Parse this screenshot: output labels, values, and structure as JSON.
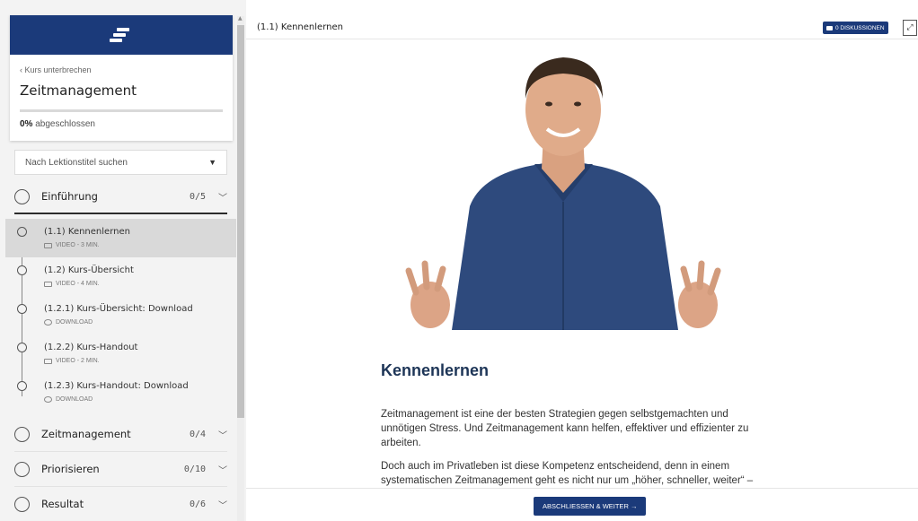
{
  "sidebar": {
    "back_link": "‹ Kurs unterbrechen",
    "course_title": "Zeitmanagement",
    "progress_value": 0,
    "progress_percent": "0%",
    "progress_suffix": "abgeschlossen",
    "search_placeholder": "Nach Lektionstitel suchen",
    "chapters": [
      {
        "title": "Einführung",
        "count": "0/5",
        "expanded": true
      },
      {
        "title": "Zeitmanagement",
        "count": "0/4",
        "expanded": false
      },
      {
        "title": "Priorisieren",
        "count": "0/10",
        "expanded": false
      },
      {
        "title": "Resultat",
        "count": "0/6",
        "expanded": false
      }
    ],
    "lessons": [
      {
        "title": "(1.1) Kennenlernen",
        "meta": "VIDEO - 3 MIN.",
        "icon": "video-icon",
        "active": true
      },
      {
        "title": "(1.2) Kurs-Übersicht",
        "meta": "VIDEO - 4 MIN.",
        "icon": "video-icon",
        "active": false
      },
      {
        "title": "(1.2.1) Kurs-Übersicht: Download",
        "meta": "DOWNLOAD",
        "icon": "download-icon",
        "active": false
      },
      {
        "title": "(1.2.2) Kurs-Handout",
        "meta": "VIDEO - 2 MIN.",
        "icon": "video-icon",
        "active": false
      },
      {
        "title": "(1.2.3) Kurs-Handout: Download",
        "meta": "DOWNLOAD",
        "icon": "download-icon",
        "active": false
      }
    ]
  },
  "main": {
    "lesson_heading": "(1.1) Kennenlernen",
    "discussions_label": "0 DISKUSSIONEN",
    "content_title": "Kennenlernen",
    "paragraph1": "Zeitmanagement ist eine der besten Strategien gegen selbstgemachten und unnötigen Stress. Und Zeitmanagement kann helfen, effektiver und effizienter zu arbeiten.",
    "paragraph2": "Doch auch im Privatleben ist diese Kompetenz entscheidend, denn in einem systematischen Zeitmanagement geht es nicht nur um „höher, schneller, weiter“ –",
    "next_button": "ABSCHLIESSEN & WEITER →"
  },
  "colors": {
    "brand": "#1b3a7a",
    "sidebar_bg": "#f3f3f3",
    "active_lesson_bg": "#d9d9d9",
    "heading_text": "#1d3557",
    "shirt": "#2e4a7d"
  }
}
